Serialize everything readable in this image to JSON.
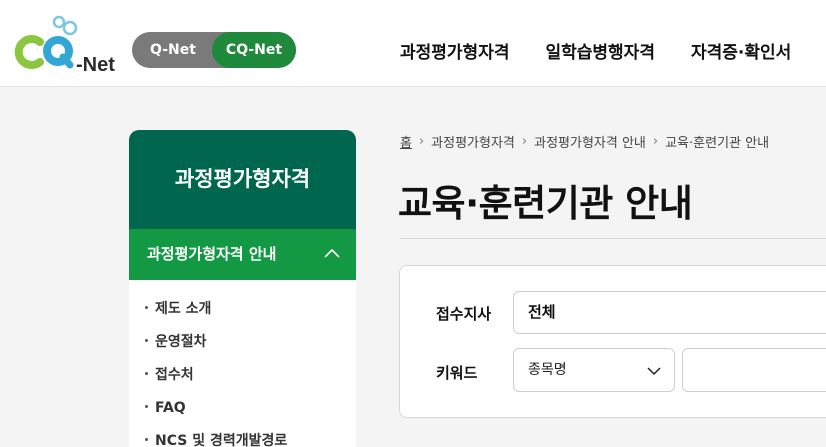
{
  "header": {
    "logo": {
      "text": "-Net",
      "mark": "CQ"
    },
    "toggle": {
      "q_label": "Q-Net",
      "cq_label": "CQ-Net"
    },
    "nav": [
      "과정평가형자격",
      "일학습병행자격",
      "자격증·확인서"
    ]
  },
  "sidebar": {
    "title": "과정평가형자격",
    "section": "과정평가형자격 안내",
    "items": [
      "제도 소개",
      "운영절차",
      "접수처",
      "FAQ",
      "NCS 및 경력개발경로"
    ]
  },
  "breadcrumb": {
    "home": "홈",
    "items": [
      "과정평가형자격",
      "과정평가형자격 안내",
      "교육·훈련기관 안내"
    ]
  },
  "page": {
    "title": "교육·훈련기관 안내"
  },
  "search": {
    "branch_label": "접수지사",
    "branch_value": "전체",
    "keyword_label": "키워드",
    "keyword_select": "종목명",
    "keyword_value": ""
  },
  "colors": {
    "sidebar_title_bg": "#00664d",
    "sidebar_section_bg": "#139844",
    "toggle_active": "#1f8a3b",
    "toggle_inactive": "#7a7a7a"
  }
}
